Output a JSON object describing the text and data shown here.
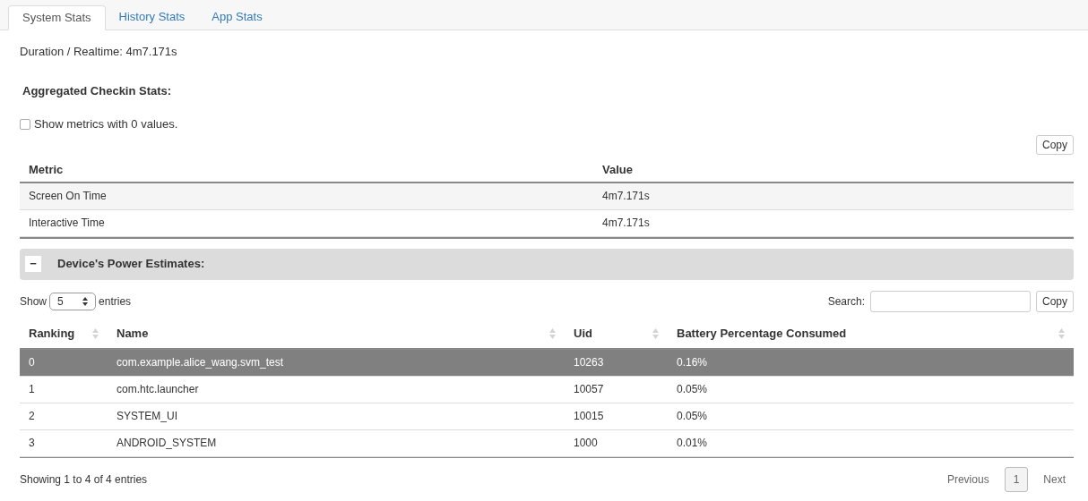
{
  "tabs": [
    {
      "label": "System Stats",
      "selected": true
    },
    {
      "label": "History Stats",
      "selected": false
    },
    {
      "label": "App Stats",
      "selected": false
    }
  ],
  "duration": "Duration / Realtime: 4m7.171s",
  "aggregated_heading": "Aggregated Checkin Stats:",
  "show_zero_checkbox": {
    "label": "Show metrics with 0 values.",
    "checked": false
  },
  "metrics_table": {
    "copy_button": "Copy",
    "columns": [
      "Metric",
      "Value"
    ],
    "rows": [
      [
        "Screen On Time",
        "4m7.171s"
      ],
      [
        "Interactive Time",
        "4m7.171s"
      ]
    ]
  },
  "power_panel": {
    "toggle": "−",
    "expanded": true,
    "title": "Device's Power Estimates:",
    "length_label_before": "Show",
    "length_value": "5",
    "length_label_after": "entries",
    "search_label": "Search:",
    "copy_button": "Copy",
    "columns": [
      "Ranking",
      "Name",
      "Uid",
      "Battery Percentage Consumed"
    ],
    "rows": [
      {
        "cells": [
          "0",
          "com.example.alice_wang.svm_test",
          "10263",
          "0.16%"
        ],
        "selected": true
      },
      {
        "cells": [
          "1",
          "com.htc.launcher",
          "10057",
          "0.05%"
        ],
        "selected": false
      },
      {
        "cells": [
          "2",
          "SYSTEM_UI",
          "10015",
          "0.05%"
        ],
        "selected": false
      },
      {
        "cells": [
          "3",
          "ANDROID_SYSTEM",
          "1000",
          "0.01%"
        ],
        "selected": false
      }
    ],
    "info": "Showing 1 to 4 of 4 entries",
    "pagination": [
      {
        "label": "Previous",
        "selected": false
      },
      {
        "label": "1",
        "selected": true
      },
      {
        "label": "Next",
        "selected": false
      }
    ]
  }
}
